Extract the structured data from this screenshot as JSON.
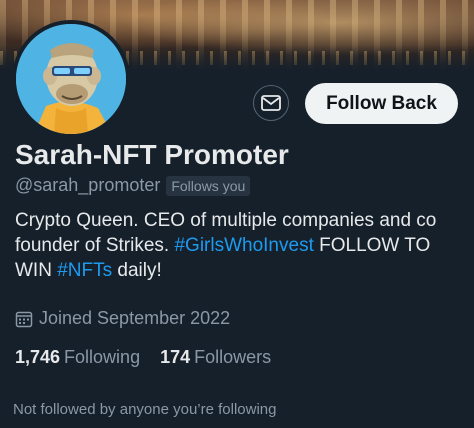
{
  "profile": {
    "name": "Sarah-NFT Promoter",
    "handle": "@sarah_promoter",
    "follows_you": "Follows you",
    "bio": {
      "text1": "Crypto Queen. CEO of multiple companies and co founder of Strikes. ",
      "hashtag1": "#GirlsWhoInvest",
      "text2": " FOLLOW TO WIN ",
      "hashtag2": "#NFTs",
      "text3": " daily!"
    },
    "joined": "Joined September 2022",
    "following_count": "1,746",
    "following_label": "Following",
    "followers_count": "174",
    "followers_label": "Followers",
    "mutuals_note": "Not followed by anyone you’re following"
  },
  "actions": {
    "follow_back_label": "Follow Back",
    "message_icon": "mail-icon"
  },
  "colors": {
    "background": "#15202b",
    "link": "#1d9bf0",
    "secondary_text": "#8b98a5",
    "button_bg": "#eff3f4"
  }
}
